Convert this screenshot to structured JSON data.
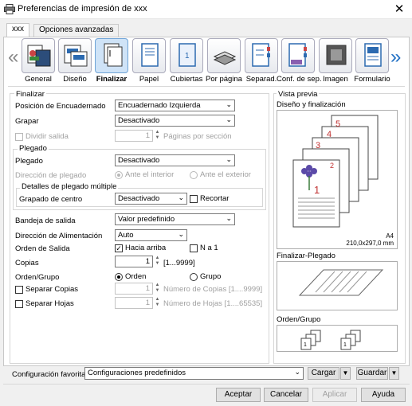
{
  "window": {
    "title": "Preferencias de impresión de xxx",
    "close": "✕"
  },
  "tabs": [
    {
      "label": "xxx"
    },
    {
      "label": "Opciones avanzadas"
    }
  ],
  "features": [
    {
      "label": "General",
      "icon": "general-icon"
    },
    {
      "label": "Diseño",
      "icon": "layout-icon"
    },
    {
      "label": "Finalizar",
      "icon": "finishing-icon",
      "selected": true
    },
    {
      "label": "Papel",
      "icon": "paper-icon"
    },
    {
      "label": "Cubiertas",
      "icon": "covers-icon"
    },
    {
      "label": "Por página",
      "icon": "per-page-icon"
    },
    {
      "label": "Separad.",
      "icon": "separator-icon"
    },
    {
      "label": "Conf. de sep.",
      "icon": "separator-settings-icon"
    },
    {
      "label": "Imagen",
      "icon": "image-icon"
    },
    {
      "label": "Formulario",
      "icon": "form-icon"
    }
  ],
  "nav": {
    "left": "«",
    "right": "»"
  },
  "finalizar": {
    "section_title": "Finalizar",
    "binding_label": "Posición de Encuadernado",
    "binding_value": "Encuadernado Izquierda",
    "staple_label": "Grapar",
    "staple_value": "Desactivado",
    "split_label": "Dividir salida",
    "split_value": "1",
    "split_unit": "Páginas por sección",
    "fold_group": "Plegado",
    "fold_label": "Plegado",
    "fold_value": "Desactivado",
    "fold_dir_label": "Dirección de plegado",
    "fold_in": "Ante el interior",
    "fold_out": "Ante el exterior",
    "multi_group": "Detalles de plegado múltiple",
    "center_staple_label": "Grapado de centro",
    "center_staple_value": "Desactivado",
    "trim_label": "Recortar",
    "tray_label": "Bandeja de salida",
    "tray_value": "Valor predefinido",
    "feed_label": "Dirección de Alimentación",
    "feed_value": "Auto",
    "order_label": "Orden de Salida",
    "face_up": "Hacia arriba",
    "n_to_1": "N a 1",
    "copies_label": "Copias",
    "copies_value": "1",
    "copies_range": "[1...9999]",
    "collate_label": "Orden/Grupo",
    "collate_order": "Orden",
    "collate_group": "Grupo",
    "sep_copies_label": "Separar Copias",
    "sep_copies_value": "1",
    "sep_copies_range": "Número de Copias [1....9999]",
    "sep_sheets_label": "Separar Hojas",
    "sep_sheets_value": "1",
    "sep_sheets_range": "Número de Hojas [1....65535]"
  },
  "preview": {
    "title": "Vista previa",
    "design_label": "Diseño y finalización",
    "page_numbers": [
      "5",
      "4",
      "3",
      "2",
      "1"
    ],
    "paper": "A4",
    "paper_size": "210,0x297,0 mm",
    "fold_label": "Finalizar-Plegado",
    "collate_label": "Orden/Grupo"
  },
  "favorites": {
    "label": "Configuración favorita",
    "value": "Configuraciones predefinidos",
    "load": "Cargar",
    "save": "Guardar"
  },
  "buttons": {
    "ok": "Aceptar",
    "cancel": "Cancelar",
    "apply": "Aplicar",
    "help": "Ayuda"
  }
}
